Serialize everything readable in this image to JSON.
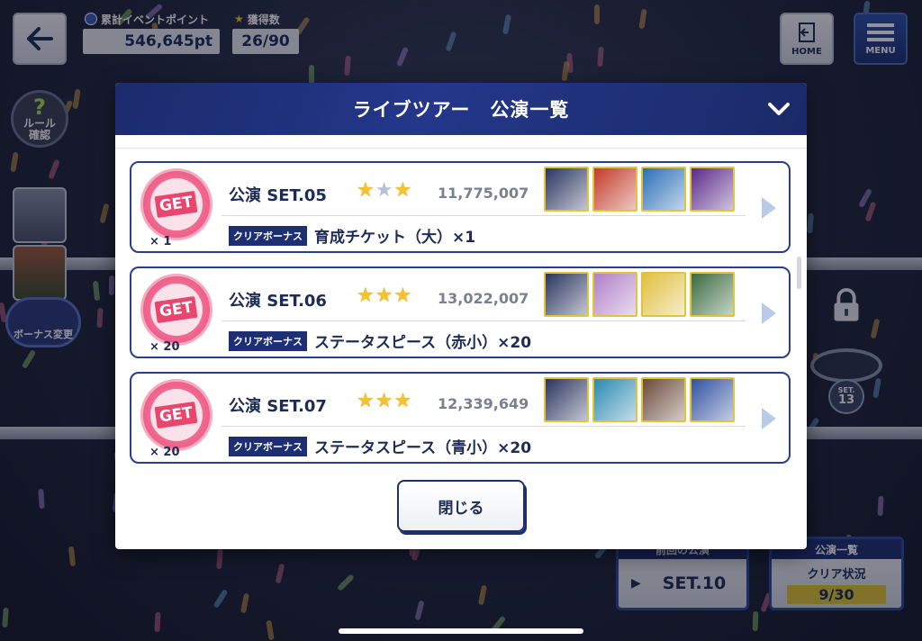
{
  "hud": {
    "event_points_label": "累計イベントポイント",
    "event_points_value": "546,645pt",
    "obtained_label": "獲得数",
    "obtained_value": "26/90",
    "home_label": "HOME",
    "menu_label": "MENU"
  },
  "side": {
    "rule_label_1": "ルール",
    "rule_label_2": "確認",
    "bonus_change_label": "ボーナス変更"
  },
  "stage": {
    "locked_set_prefix": "SET.",
    "locked_set_number": "13",
    "prev_card_head": "前回の公演",
    "prev_card_value": "SET.10",
    "status_card_head": "公演一覧",
    "status_card_label": "クリア状況",
    "status_card_count": "9/30"
  },
  "modal": {
    "title": "ライブツアー　公演一覧",
    "close_label": "閉じる",
    "bonus_tag": "クリアボーナス",
    "get_label": "GET",
    "rows": [
      {
        "set_name": "公演 SET.05",
        "stars": [
          true,
          false,
          true
        ],
        "score": "11,775,007",
        "bonus": "育成チケット（大）×1",
        "qty": "× 1",
        "thumbs": [
          "#2a3560",
          "#c43a2a",
          "#2a6fb8",
          "#5a2a8a"
        ]
      },
      {
        "set_name": "公演 SET.06",
        "stars": [
          true,
          true,
          true
        ],
        "score": "13,022,007",
        "bonus": "ステータスピース（赤小）×20",
        "qty": "× 20",
        "thumbs": [
          "#2a3560",
          "#b080c8",
          "#e0c040",
          "#3a6a40"
        ]
      },
      {
        "set_name": "公演 SET.07",
        "stars": [
          true,
          true,
          true
        ],
        "score": "12,339,649",
        "bonus": "ステータスピース（青小）×20",
        "qty": "× 20",
        "thumbs": [
          "#2a3560",
          "#2a8ab0",
          "#6a4a3a",
          "#3050a0"
        ]
      }
    ]
  }
}
